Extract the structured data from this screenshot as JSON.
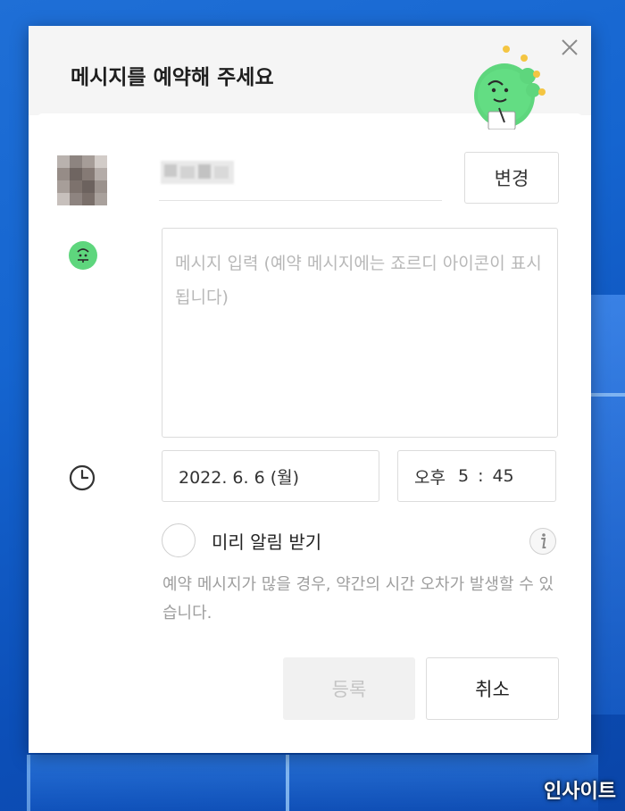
{
  "dialog": {
    "title": "메시지를 예약해 주세요",
    "close_icon": "close-icon",
    "mascot_icon": "cactus-mascot-icon"
  },
  "recipient": {
    "avatar_icon": "blurred-avatar",
    "change_label": "변경"
  },
  "message": {
    "placeholder": "메시지 입력 (예약 메시지에는 죠르디 아이콘이 표시됩니다)",
    "value": ""
  },
  "schedule": {
    "date": "2022. 6. 6 (월)",
    "ampm": "오후",
    "hour": "5",
    "separator": ":",
    "minute": "45"
  },
  "reminder": {
    "label": "미리 알림 받기",
    "checked": false,
    "info_icon": "info-icon"
  },
  "notice": "예약 메시지가 많을 경우, 약간의 시간 오차가 발생할 수 있습니다.",
  "actions": {
    "register_label": "등록",
    "cancel_label": "취소"
  },
  "watermark": "인사이트",
  "colors": {
    "accent_green": "#5ed67d",
    "desktop_blue": "#1565d0",
    "disabled_bg": "#f1f1f1",
    "placeholder_gray": "#b8b8b8"
  }
}
